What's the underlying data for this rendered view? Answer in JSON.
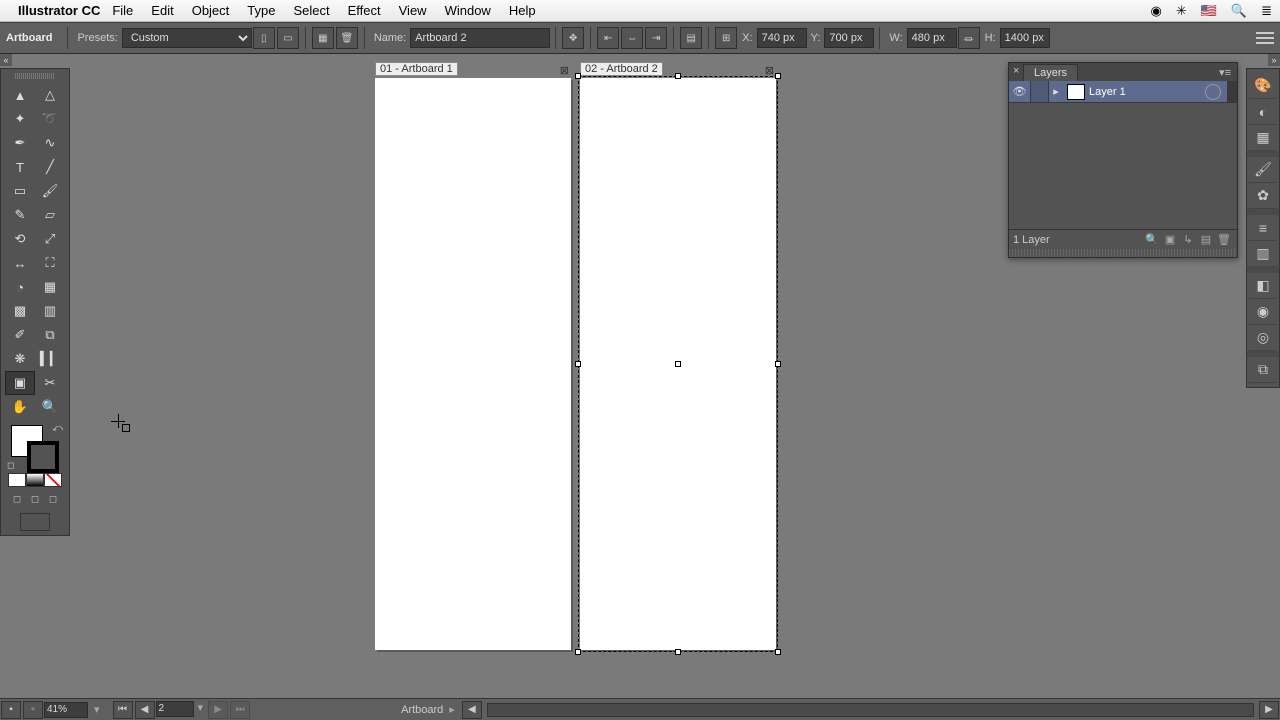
{
  "menubar": {
    "app": "Illustrator CC",
    "items": [
      "File",
      "Edit",
      "Object",
      "Type",
      "Select",
      "Effect",
      "View",
      "Window",
      "Help"
    ],
    "rightIcons": [
      "cc",
      "sync",
      "flag",
      "search",
      "menu"
    ]
  },
  "controlbar": {
    "mode": "Artboard",
    "presets_label": "Presets:",
    "presets_value": "Custom",
    "name_label": "Name:",
    "name_value": "Artboard 2",
    "x_label": "X:",
    "x_value": "740 px",
    "y_label": "Y:",
    "y_value": "700 px",
    "w_label": "W:",
    "w_value": "480 px",
    "h_label": "H:",
    "h_value": "1400 px"
  },
  "artboards": {
    "ab1_label": "01 - Artboard 1",
    "ab2_label": "02 - Artboard 2"
  },
  "layers": {
    "title": "Layers",
    "items": [
      {
        "name": "Layer 1"
      }
    ],
    "count": "1 Layer"
  },
  "statusbar": {
    "zoom": "41%",
    "artboard_index": "2",
    "doc": "Artboard"
  },
  "tools": {
    "left": [
      "selection",
      "direct-selection",
      "magic-wand",
      "lasso",
      "pen",
      "curvature",
      "type",
      "line",
      "rectangle",
      "paintbrush",
      "pencil",
      "eraser",
      "rotate",
      "scale",
      "width",
      "free-transform",
      "shape-builder",
      "perspective",
      "mesh",
      "gradient",
      "eyedropper",
      "blend",
      "symbol-sprayer",
      "column-graph",
      "artboard",
      "slice",
      "hand",
      "zoom"
    ],
    "rightDock": [
      "color",
      "color-guide",
      "swatches",
      "brushes",
      "symbols",
      "stroke",
      "gradient",
      "transparency",
      "appearance",
      "graphic-styles",
      "align",
      "transform",
      "pathfinder",
      "artboards"
    ]
  }
}
